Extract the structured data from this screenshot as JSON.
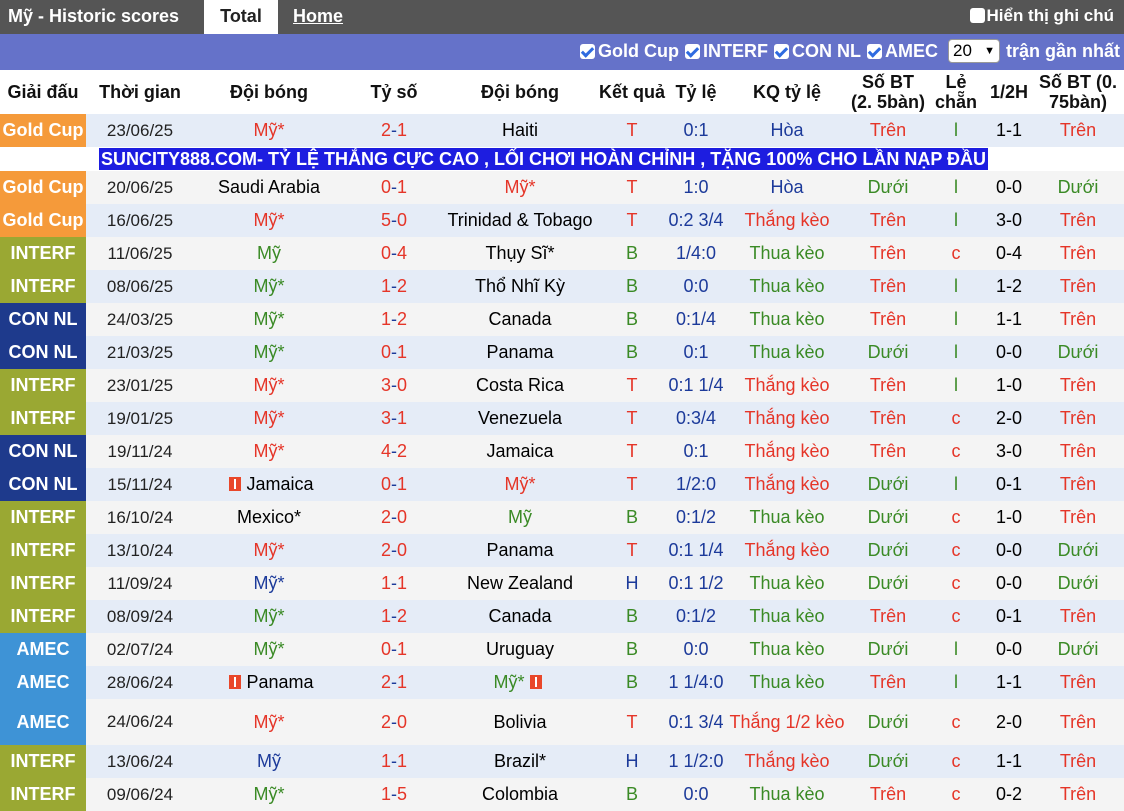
{
  "header": {
    "title": "Mỹ - Historic scores",
    "tab_total": "Total",
    "tab_home": "Home",
    "show_notes": "Hiển thị ghi chú"
  },
  "filters": {
    "items": [
      "Gold Cup",
      "INTERF",
      "CON NL",
      "AMEC"
    ],
    "count_value": "20",
    "count_suffix": "trận gần nhất"
  },
  "columns": [
    "Giải đấu",
    "Thời gian",
    "Đội bóng",
    "Tỷ số",
    "Đội bóng",
    "Kết quả",
    "Tỷ lệ",
    "KQ tỷ lệ",
    "Số BT (2. 5bàn)",
    "Lẻ chẵn",
    "1/2H",
    "Số BT (0. 75bàn)"
  ],
  "ad_banner": "SUNCITY888.COM- TỶ LỆ THẮNG CỰC CAO , LỐI CHƠI HOÀN CHỈNH , TẶNG 100% CHO LẦN NẠP ĐẦU",
  "colors": {
    "goldcup": "#f59a3a",
    "interf": "#9aa833",
    "connl": "#1e3a8c",
    "amec": "#3e93d6",
    "win_red": "#e53528",
    "loss_green": "#3a8a25"
  },
  "rows": [
    {
      "league": "Gold Cup",
      "date": "23/06/25",
      "home": "Mỹ*",
      "home_style": "red",
      "score_h": "2",
      "score_a": "1",
      "away": "Haiti",
      "away_style": "",
      "res": "T",
      "odds": "0:1",
      "kq": "Hòa",
      "bt": "Trên",
      "lc": "l",
      "half": "1-1",
      "bt2": "Trên"
    },
    {
      "league": "Gold Cup",
      "date": "20/06/25",
      "home": "Saudi Arabia",
      "home_style": "",
      "score_h": "0",
      "score_a": "1",
      "away": "Mỹ*",
      "away_style": "red",
      "res": "T",
      "odds": "1:0",
      "kq": "Hòa",
      "bt": "Dưới",
      "lc": "l",
      "half": "0-0",
      "bt2": "Dưới"
    },
    {
      "league": "Gold Cup",
      "date": "16/06/25",
      "home": "Mỹ*",
      "home_style": "red",
      "score_h": "5",
      "score_a": "0",
      "away": "Trinidad & Tobago",
      "away_style": "",
      "res": "T",
      "odds": "0:2 3/4",
      "kq": "Thắng kèo",
      "bt": "Trên",
      "lc": "l",
      "half": "3-0",
      "bt2": "Trên"
    },
    {
      "league": "INTERF",
      "date": "11/06/25",
      "home": "Mỹ",
      "home_style": "green",
      "score_h": "0",
      "score_a": "4",
      "away": "Thụy Sĩ*",
      "away_style": "",
      "res": "B",
      "odds": "1/4:0",
      "kq": "Thua kèo",
      "bt": "Trên",
      "lc": "c",
      "half": "0-4",
      "bt2": "Trên"
    },
    {
      "league": "INTERF",
      "date": "08/06/25",
      "home": "Mỹ*",
      "home_style": "green",
      "score_h": "1",
      "score_a": "2",
      "away": "Thổ Nhĩ Kỳ",
      "away_style": "",
      "res": "B",
      "odds": "0:0",
      "kq": "Thua kèo",
      "bt": "Trên",
      "lc": "l",
      "half": "1-2",
      "bt2": "Trên"
    },
    {
      "league": "CON NL",
      "date": "24/03/25",
      "home": "Mỹ*",
      "home_style": "green",
      "score_h": "1",
      "score_a": "2",
      "away": "Canada",
      "away_style": "",
      "res": "B",
      "odds": "0:1/4",
      "kq": "Thua kèo",
      "bt": "Trên",
      "lc": "l",
      "half": "1-1",
      "bt2": "Trên"
    },
    {
      "league": "CON NL",
      "date": "21/03/25",
      "home": "Mỹ*",
      "home_style": "green",
      "score_h": "0",
      "score_a": "1",
      "away": "Panama",
      "away_style": "",
      "res": "B",
      "odds": "0:1",
      "kq": "Thua kèo",
      "bt": "Dưới",
      "lc": "l",
      "half": "0-0",
      "bt2": "Dưới"
    },
    {
      "league": "INTERF",
      "date": "23/01/25",
      "home": "Mỹ*",
      "home_style": "red",
      "score_h": "3",
      "score_a": "0",
      "away": "Costa Rica",
      "away_style": "",
      "res": "T",
      "odds": "0:1 1/4",
      "kq": "Thắng kèo",
      "bt": "Trên",
      "lc": "l",
      "half": "1-0",
      "bt2": "Trên"
    },
    {
      "league": "INTERF",
      "date": "19/01/25",
      "home": "Mỹ*",
      "home_style": "red",
      "score_h": "3",
      "score_a": "1",
      "away": "Venezuela",
      "away_style": "",
      "res": "T",
      "odds": "0:3/4",
      "kq": "Thắng kèo",
      "bt": "Trên",
      "lc": "c",
      "half": "2-0",
      "bt2": "Trên"
    },
    {
      "league": "CON NL",
      "date": "19/11/24",
      "home": "Mỹ*",
      "home_style": "red",
      "score_h": "4",
      "score_a": "2",
      "away": "Jamaica",
      "away_style": "",
      "res": "T",
      "odds": "0:1",
      "kq": "Thắng kèo",
      "bt": "Trên",
      "lc": "c",
      "half": "3-0",
      "bt2": "Trên"
    },
    {
      "league": "CON NL",
      "date": "15/11/24",
      "home": "Jamaica",
      "home_style": "",
      "home_flag": true,
      "score_h": "0",
      "score_a": "1",
      "away": "Mỹ*",
      "away_style": "red",
      "res": "T",
      "odds": "1/2:0",
      "kq": "Thắng kèo",
      "bt": "Dưới",
      "lc": "l",
      "half": "0-1",
      "bt2": "Trên"
    },
    {
      "league": "INTERF",
      "date": "16/10/24",
      "home": "Mexico*",
      "home_style": "",
      "score_h": "2",
      "score_a": "0",
      "away": "Mỹ",
      "away_style": "green",
      "res": "B",
      "odds": "0:1/2",
      "kq": "Thua kèo",
      "bt": "Dưới",
      "lc": "c",
      "half": "1-0",
      "bt2": "Trên"
    },
    {
      "league": "INTERF",
      "date": "13/10/24",
      "home": "Mỹ*",
      "home_style": "red",
      "score_h": "2",
      "score_a": "0",
      "away": "Panama",
      "away_style": "",
      "res": "T",
      "odds": "0:1 1/4",
      "kq": "Thắng kèo",
      "bt": "Dưới",
      "lc": "c",
      "half": "0-0",
      "bt2": "Dưới"
    },
    {
      "league": "INTERF",
      "date": "11/09/24",
      "home": "Mỹ*",
      "home_style": "blue",
      "score_h": "1",
      "score_a": "1",
      "away": "New Zealand",
      "away_style": "",
      "res": "H",
      "odds": "0:1 1/2",
      "kq": "Thua kèo",
      "bt": "Dưới",
      "lc": "c",
      "half": "0-0",
      "bt2": "Dưới"
    },
    {
      "league": "INTERF",
      "date": "08/09/24",
      "home": "Mỹ*",
      "home_style": "green",
      "score_h": "1",
      "score_a": "2",
      "away": "Canada",
      "away_style": "",
      "res": "B",
      "odds": "0:1/2",
      "kq": "Thua kèo",
      "bt": "Trên",
      "lc": "c",
      "half": "0-1",
      "bt2": "Trên"
    },
    {
      "league": "AMEC",
      "date": "02/07/24",
      "home": "Mỹ*",
      "home_style": "green",
      "score_h": "0",
      "score_a": "1",
      "away": "Uruguay",
      "away_style": "",
      "res": "B",
      "odds": "0:0",
      "kq": "Thua kèo",
      "bt": "Dưới",
      "lc": "l",
      "half": "0-0",
      "bt2": "Dưới"
    },
    {
      "league": "AMEC",
      "date": "28/06/24",
      "home": "Panama",
      "home_style": "",
      "home_flag": true,
      "score_h": "2",
      "score_a": "1",
      "away": "Mỹ*",
      "away_style": "green",
      "away_flag": true,
      "res": "B",
      "odds": "1 1/4:0",
      "kq": "Thua kèo",
      "bt": "Trên",
      "lc": "l",
      "half": "1-1",
      "bt2": "Trên"
    },
    {
      "league": "AMEC",
      "date": "24/06/24",
      "home": "Mỹ*",
      "home_style": "red",
      "score_h": "2",
      "score_a": "0",
      "away": "Bolivia",
      "away_style": "",
      "res": "T",
      "odds": "0:1 3/4",
      "kq": "Thắng 1/2 kèo",
      "bt": "Dưới",
      "lc": "c",
      "half": "2-0",
      "bt2": "Trên"
    },
    {
      "league": "INTERF",
      "date": "13/06/24",
      "home": "Mỹ",
      "home_style": "blue",
      "score_h": "1",
      "score_a": "1",
      "away": "Brazil*",
      "away_style": "",
      "res": "H",
      "odds": "1 1/2:0",
      "kq": "Thắng kèo",
      "bt": "Dưới",
      "lc": "c",
      "half": "1-1",
      "bt2": "Trên"
    },
    {
      "league": "INTERF",
      "date": "09/06/24",
      "home": "Mỹ*",
      "home_style": "green",
      "score_h": "1",
      "score_a": "5",
      "away": "Colombia",
      "away_style": "",
      "res": "B",
      "odds": "0:0",
      "kq": "Thua kèo",
      "bt": "Trên",
      "lc": "c",
      "half": "0-2",
      "bt2": "Trên"
    }
  ]
}
